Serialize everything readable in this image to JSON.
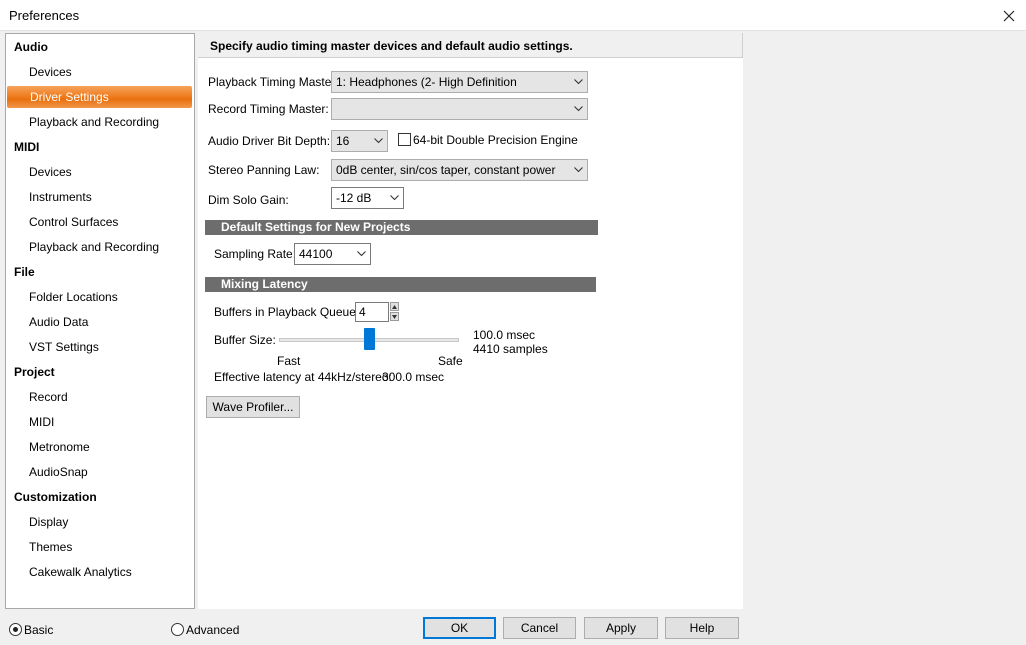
{
  "window": {
    "title": "Preferences"
  },
  "tree": {
    "categories": [
      {
        "label": "Audio",
        "items": [
          "Devices",
          "Driver Settings",
          "Playback and Recording"
        ]
      },
      {
        "label": "MIDI",
        "items": [
          "Devices",
          "Instruments",
          "Control Surfaces",
          "Playback and Recording"
        ]
      },
      {
        "label": "File",
        "items": [
          "Folder Locations",
          "Audio Data",
          "VST Settings"
        ]
      },
      {
        "label": "Project",
        "items": [
          "Record",
          "MIDI",
          "Metronome",
          "AudioSnap"
        ]
      },
      {
        "label": "Customization",
        "items": [
          "Display",
          "Themes",
          "Cakewalk Analytics"
        ]
      }
    ],
    "selected_item": "Driver Settings"
  },
  "panel": {
    "header": "Specify audio timing master devices and default audio settings.",
    "playback_timing_master": {
      "label": "Playback Timing Master:",
      "value": "1: Headphones (2- High Definition"
    },
    "record_timing_master": {
      "label": "Record Timing Master:",
      "value": ""
    },
    "bit_depth": {
      "label": "Audio Driver Bit Depth:",
      "value": "16"
    },
    "double_precision": {
      "label": "64-bit Double Precision Engine",
      "checked": false
    },
    "panning_law": {
      "label": "Stereo Panning Law:",
      "value": "0dB center, sin/cos taper, constant power"
    },
    "dim_solo": {
      "label": "Dim Solo Gain:",
      "value": "-12 dB"
    },
    "defaults_section": {
      "title": "Default Settings for New Projects"
    },
    "sampling_rate": {
      "label": "Sampling Rate:",
      "value": "44100"
    },
    "latency_section": {
      "title": "Mixing Latency"
    },
    "buffers": {
      "label": "Buffers in Playback Queue:",
      "value": "4"
    },
    "buffer_size": {
      "label": "Buffer Size:",
      "min_label": "Fast",
      "max_label": "Safe",
      "level": 0.5,
      "msec": "100.0 msec",
      "samples": "4410 samples"
    },
    "effective_latency": {
      "label": "Effective latency at 44kHz/stereo:",
      "value": "300.0 msec"
    },
    "wave_profiler": "Wave Profiler..."
  },
  "footer": {
    "mode_basic": "Basic",
    "mode_advanced": "Advanced",
    "selected_mode": "Basic",
    "ok": "OK",
    "cancel": "Cancel",
    "apply": "Apply",
    "help": "Help"
  },
  "colors": {
    "selection_orange": "#ef7f22",
    "section_bar": "#6d6d6d",
    "slider_thumb": "#0078d7"
  }
}
